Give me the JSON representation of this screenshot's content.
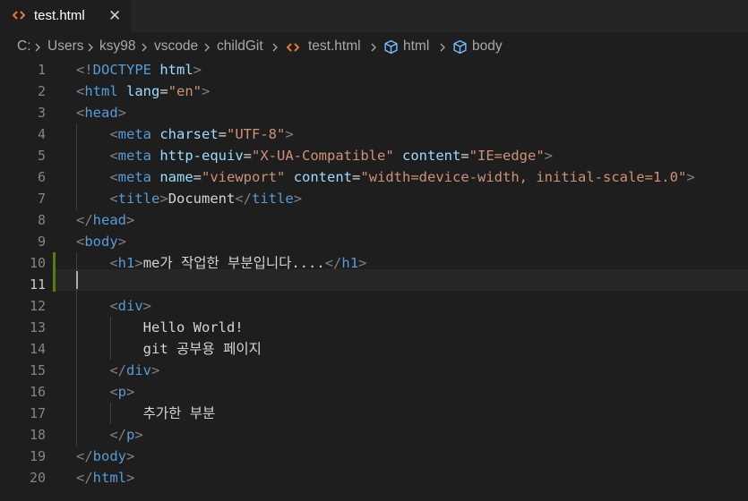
{
  "tab": {
    "label": "test.html",
    "icon": "html-file-icon",
    "close_icon": "close-icon",
    "close_glyph": "✕",
    "icon_color": "#e37933"
  },
  "breadcrumb": {
    "items": [
      "C:",
      "Users",
      "ksy98",
      "vscode",
      "childGit",
      "test.html",
      "html",
      "body"
    ],
    "separator_icon": "chevron-right-icon",
    "symbol_icon": "html-element-icon"
  },
  "colors": {
    "background": "#1e1e1e",
    "tab_bar": "#252526",
    "tag": "#569cd6",
    "attribute": "#9cdcfe",
    "string": "#ce9178",
    "bracket": "#808080",
    "text": "#d4d4d4",
    "modified_gutter": "#587c0c",
    "line_number": "#858585"
  },
  "editor": {
    "active_line": 11,
    "lines": [
      {
        "n": "1",
        "tokens": [
          {
            "c": "g",
            "v": "<!"
          },
          {
            "c": "t",
            "v": "DOCTYPE"
          },
          {
            "c": "x",
            "v": " "
          },
          {
            "c": "a",
            "v": "html"
          },
          {
            "c": "g",
            "v": ">"
          }
        ]
      },
      {
        "n": "2",
        "tokens": [
          {
            "c": "g",
            "v": "<"
          },
          {
            "c": "t",
            "v": "html"
          },
          {
            "c": "x",
            "v": " "
          },
          {
            "c": "a",
            "v": "lang"
          },
          {
            "c": "x",
            "v": "="
          },
          {
            "c": "s",
            "v": "\"en\""
          },
          {
            "c": "g",
            "v": ">"
          }
        ]
      },
      {
        "n": "3",
        "tokens": [
          {
            "c": "g",
            "v": "<"
          },
          {
            "c": "t",
            "v": "head"
          },
          {
            "c": "g",
            "v": ">"
          }
        ]
      },
      {
        "n": "4",
        "tokens": [
          {
            "c": "x",
            "v": "    "
          },
          {
            "c": "g",
            "v": "<"
          },
          {
            "c": "t",
            "v": "meta"
          },
          {
            "c": "x",
            "v": " "
          },
          {
            "c": "a",
            "v": "charset"
          },
          {
            "c": "x",
            "v": "="
          },
          {
            "c": "s",
            "v": "\"UTF-8\""
          },
          {
            "c": "g",
            "v": ">"
          }
        ]
      },
      {
        "n": "5",
        "tokens": [
          {
            "c": "x",
            "v": "    "
          },
          {
            "c": "g",
            "v": "<"
          },
          {
            "c": "t",
            "v": "meta"
          },
          {
            "c": "x",
            "v": " "
          },
          {
            "c": "a",
            "v": "http-equiv"
          },
          {
            "c": "x",
            "v": "="
          },
          {
            "c": "s",
            "v": "\"X-UA-Compatible\""
          },
          {
            "c": "x",
            "v": " "
          },
          {
            "c": "a",
            "v": "content"
          },
          {
            "c": "x",
            "v": "="
          },
          {
            "c": "s",
            "v": "\"IE=edge\""
          },
          {
            "c": "g",
            "v": ">"
          }
        ]
      },
      {
        "n": "6",
        "tokens": [
          {
            "c": "x",
            "v": "    "
          },
          {
            "c": "g",
            "v": "<"
          },
          {
            "c": "t",
            "v": "meta"
          },
          {
            "c": "x",
            "v": " "
          },
          {
            "c": "a",
            "v": "name"
          },
          {
            "c": "x",
            "v": "="
          },
          {
            "c": "s",
            "v": "\"viewport\""
          },
          {
            "c": "x",
            "v": " "
          },
          {
            "c": "a",
            "v": "content"
          },
          {
            "c": "x",
            "v": "="
          },
          {
            "c": "s",
            "v": "\"width=device-width, initial-scale=1.0\""
          },
          {
            "c": "g",
            "v": ">"
          }
        ]
      },
      {
        "n": "7",
        "tokens": [
          {
            "c": "x",
            "v": "    "
          },
          {
            "c": "g",
            "v": "<"
          },
          {
            "c": "t",
            "v": "title"
          },
          {
            "c": "g",
            "v": ">"
          },
          {
            "c": "x",
            "v": "Document"
          },
          {
            "c": "g",
            "v": "</"
          },
          {
            "c": "t",
            "v": "title"
          },
          {
            "c": "g",
            "v": ">"
          }
        ]
      },
      {
        "n": "8",
        "tokens": [
          {
            "c": "g",
            "v": "</"
          },
          {
            "c": "t",
            "v": "head"
          },
          {
            "c": "g",
            "v": ">"
          }
        ]
      },
      {
        "n": "9",
        "tokens": [
          {
            "c": "g",
            "v": "<"
          },
          {
            "c": "t",
            "v": "body"
          },
          {
            "c": "g",
            "v": ">"
          }
        ]
      },
      {
        "n": "10",
        "tokens": [
          {
            "c": "x",
            "v": "    "
          },
          {
            "c": "g",
            "v": "<"
          },
          {
            "c": "t",
            "v": "h1"
          },
          {
            "c": "g",
            "v": ">"
          },
          {
            "c": "x",
            "v": "me가 작업한 부분입니다...."
          },
          {
            "c": "g",
            "v": "</"
          },
          {
            "c": "t",
            "v": "h1"
          },
          {
            "c": "g",
            "v": ">"
          }
        ]
      },
      {
        "n": "11",
        "tokens": []
      },
      {
        "n": "12",
        "tokens": [
          {
            "c": "x",
            "v": "    "
          },
          {
            "c": "g",
            "v": "<"
          },
          {
            "c": "t",
            "v": "div"
          },
          {
            "c": "g",
            "v": ">"
          }
        ]
      },
      {
        "n": "13",
        "tokens": [
          {
            "c": "x",
            "v": "        Hello World!"
          }
        ]
      },
      {
        "n": "14",
        "tokens": [
          {
            "c": "x",
            "v": "        git 공부용 페이지"
          }
        ]
      },
      {
        "n": "15",
        "tokens": [
          {
            "c": "x",
            "v": "    "
          },
          {
            "c": "g",
            "v": "</"
          },
          {
            "c": "t",
            "v": "div"
          },
          {
            "c": "g",
            "v": ">"
          }
        ]
      },
      {
        "n": "16",
        "tokens": [
          {
            "c": "x",
            "v": "    "
          },
          {
            "c": "g",
            "v": "<"
          },
          {
            "c": "t",
            "v": "p"
          },
          {
            "c": "g",
            "v": ">"
          }
        ]
      },
      {
        "n": "17",
        "tokens": [
          {
            "c": "x",
            "v": "        추가한 부분"
          }
        ]
      },
      {
        "n": "18",
        "tokens": [
          {
            "c": "x",
            "v": "    "
          },
          {
            "c": "g",
            "v": "</"
          },
          {
            "c": "t",
            "v": "p"
          },
          {
            "c": "g",
            "v": ">"
          }
        ]
      },
      {
        "n": "19",
        "tokens": [
          {
            "c": "g",
            "v": "</"
          },
          {
            "c": "t",
            "v": "body"
          },
          {
            "c": "g",
            "v": ">"
          }
        ]
      },
      {
        "n": "20",
        "tokens": [
          {
            "c": "g",
            "v": "</"
          },
          {
            "c": "t",
            "v": "html"
          },
          {
            "c": "g",
            "v": ">"
          }
        ]
      }
    ]
  }
}
